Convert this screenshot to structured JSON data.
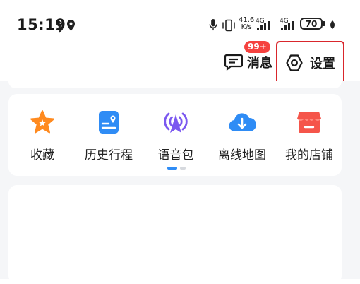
{
  "status_bar": {
    "time": "15:19",
    "network_speed_value": "41.6",
    "network_speed_unit": "K/s",
    "signal1_label": "4G",
    "signal2_label": "4G",
    "battery": "70",
    "icons": [
      "bluetooth-icon",
      "location-icon",
      "microphone-icon",
      "vibrate-icon",
      "signal-icon",
      "signal-icon",
      "battery-icon",
      "leaf-icon"
    ]
  },
  "header": {
    "messages_label": "消息",
    "messages_badge": "99+",
    "settings_label": "设置"
  },
  "quick_actions": {
    "items": [
      {
        "label": "收藏",
        "icon": "star-icon",
        "color": "#ff8a1f"
      },
      {
        "label": "历史行程",
        "icon": "itinerary-icon",
        "color": "#2f8cf5"
      },
      {
        "label": "语音包",
        "icon": "voice-broadcast-icon",
        "color": "#7b58f0"
      },
      {
        "label": "离线地图",
        "icon": "cloud-download-icon",
        "color": "#2f8cf5"
      },
      {
        "label": "我的店铺",
        "icon": "store-icon",
        "color": "#f5554a"
      }
    ],
    "pager_pages": 2,
    "pager_active": 0
  },
  "colors": {
    "highlight_border": "#d9262c",
    "badge": "#f5423f",
    "page_background": "#f5f6f8",
    "pager_active": "#2f8cf5",
    "pager_inactive": "#d6d9de"
  }
}
